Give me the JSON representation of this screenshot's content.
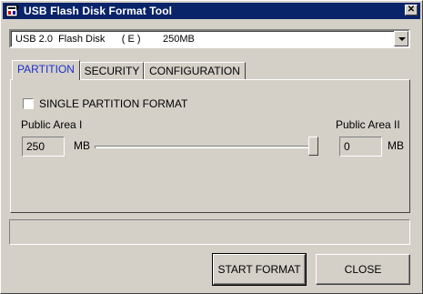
{
  "window": {
    "title": "USB Flash Disk Format Tool",
    "close_glyph": "✕"
  },
  "device_select": {
    "value": "USB 2.0  Flash Disk      ( E )        250MB"
  },
  "tabs": [
    {
      "label": "PARTITION",
      "active": true
    },
    {
      "label": "SECURITY",
      "active": false
    },
    {
      "label": "CONFIGURATION",
      "active": false
    }
  ],
  "partition": {
    "single_partition_label": "SINGLE PARTITION FORMAT",
    "single_partition_checked": false,
    "public_area_1_label": "Public Area I",
    "public_area_1_value": "250",
    "public_area_1_unit": "MB",
    "public_area_2_label": "Public Area II",
    "public_area_2_value": "0",
    "public_area_2_unit": "MB",
    "slider_fraction": 1.0
  },
  "progress": {
    "fraction": 0
  },
  "buttons": {
    "start_label": "START FORMAT",
    "close_label": "CLOSE"
  },
  "colors": {
    "titlebar": "#0a246a",
    "active_tab_text": "#1a2fc8",
    "face": "#d4d0c8"
  }
}
